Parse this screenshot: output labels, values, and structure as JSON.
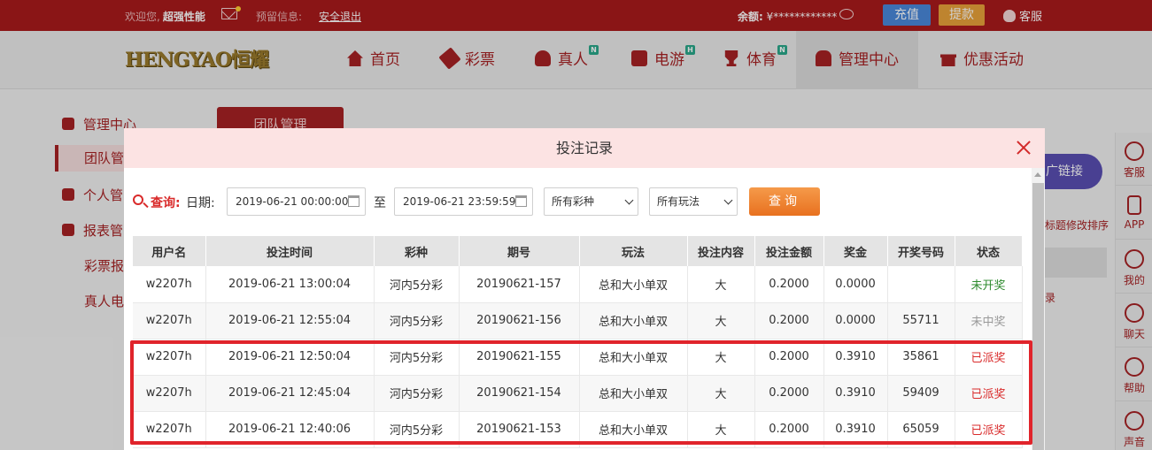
{
  "topbar": {
    "welcome_prefix": "欢迎您,",
    "username": "超强性能",
    "notice_label": "预留信息:",
    "logout": "安全退出",
    "balance_label": "余额:",
    "balance_value": "¥************",
    "recharge": "充值",
    "withdraw": "提款",
    "service": "客服"
  },
  "nav": {
    "logo_text": "HENGYAO",
    "logo_cn": "恒耀",
    "items": [
      {
        "label": "首页",
        "icon": "home-icon"
      },
      {
        "label": "彩票",
        "icon": "ticket-icon"
      },
      {
        "label": "真人",
        "icon": "live-dealer-icon",
        "badge": "N"
      },
      {
        "label": "电游",
        "icon": "game-icon",
        "badge": "H"
      },
      {
        "label": "体育",
        "icon": "trophy-icon",
        "badge": "N"
      },
      {
        "label": "管理中心",
        "icon": "group-icon"
      },
      {
        "label": "优惠活动",
        "icon": "gift-icon"
      }
    ]
  },
  "background": {
    "side_menu": [
      {
        "label": "管理中心"
      },
      {
        "label": "团队管"
      },
      {
        "label": "个人管"
      },
      {
        "label": "报表管"
      },
      {
        "label": "彩票报"
      },
      {
        "label": "真人电"
      }
    ],
    "tab": "团队管理",
    "promo_link": "广链接",
    "sort_note": "标题修改排序",
    "record_fragment": "录",
    "right_bar": [
      "客服",
      "APP",
      "我的",
      "聊天",
      "帮助",
      "声音"
    ]
  },
  "modal": {
    "title": "投注记录",
    "query_label": "查询:",
    "date_label": "日期:",
    "date_from": "2019-06-21 00:00:00",
    "to_label": "至",
    "date_to": "2019-06-21 23:59:59",
    "lottery_select": "所有彩种",
    "play_select": "所有玩法",
    "query_button": "查询",
    "columns": [
      "用户名",
      "投注时间",
      "彩种",
      "期号",
      "玩法",
      "投注内容",
      "投注金额",
      "奖金",
      "开奖号码",
      "状态"
    ],
    "rows": [
      {
        "user": "w2207h",
        "time": "2019-06-21 13:00:04",
        "lottery": "河内5分彩",
        "issue": "20190621-157",
        "play": "总和大小单双",
        "content": "大",
        "amount": "0.2000",
        "prize": "0.0000",
        "draw": "",
        "status": "未开奖",
        "status_type": "open"
      },
      {
        "user": "w2207h",
        "time": "2019-06-21 12:55:04",
        "lottery": "河内5分彩",
        "issue": "20190621-156",
        "play": "总和大小单双",
        "content": "大",
        "amount": "0.2000",
        "prize": "0.0000",
        "draw": "55711",
        "status": "未中奖",
        "status_type": "lose"
      },
      {
        "user": "w2207h",
        "time": "2019-06-21 12:50:04",
        "lottery": "河内5分彩",
        "issue": "20190621-155",
        "play": "总和大小单双",
        "content": "大",
        "amount": "0.2000",
        "prize": "0.3910",
        "draw": "35861",
        "status": "已派奖",
        "status_type": "paid"
      },
      {
        "user": "w2207h",
        "time": "2019-06-21 12:45:04",
        "lottery": "河内5分彩",
        "issue": "20190621-154",
        "play": "总和大小单双",
        "content": "大",
        "amount": "0.2000",
        "prize": "0.3910",
        "draw": "59409",
        "status": "已派奖",
        "status_type": "paid"
      },
      {
        "user": "w2207h",
        "time": "2019-06-21 12:40:06",
        "lottery": "河内5分彩",
        "issue": "20190621-153",
        "play": "总和大小单双",
        "content": "大",
        "amount": "0.2000",
        "prize": "0.3910",
        "draw": "65059",
        "status": "已派奖",
        "status_type": "paid"
      }
    ]
  },
  "colors": {
    "brand_red": "#a91a1c",
    "status_open": "#2e8b2e",
    "status_lose": "#999999",
    "status_paid": "#d92a2a",
    "highlight": "#e0242b"
  }
}
